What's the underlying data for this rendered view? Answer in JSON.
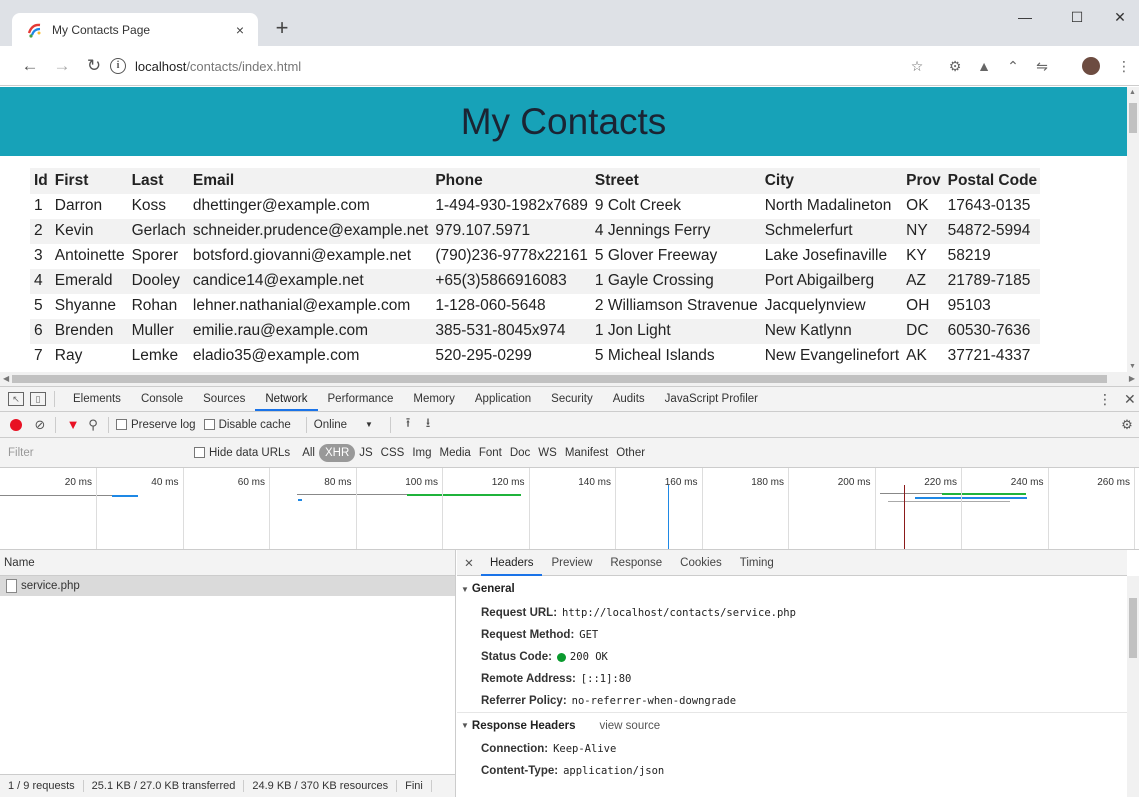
{
  "browser": {
    "tab_title": "My Contacts Page",
    "tab_close": "×",
    "new_tab": "+",
    "minimize": "—",
    "maximize": "☐",
    "close": "✕",
    "url_host": "localhost",
    "url_path": "/contacts/index.html"
  },
  "page": {
    "title": "My Contacts",
    "columns": [
      "Id",
      "First",
      "Last",
      "Email",
      "Phone",
      "Street",
      "City",
      "Prov",
      "Postal Code"
    ],
    "rows": [
      [
        "1",
        "Darron",
        "Koss",
        "dhettinger@example.com",
        "1-494-930-1982x7689",
        "9 Colt Creek",
        "North Madalineton",
        "OK",
        "17643-0135"
      ],
      [
        "2",
        "Kevin",
        "Gerlach",
        "schneider.prudence@example.net",
        "979.107.5971",
        "4 Jennings Ferry",
        "Schmelerfurt",
        "NY",
        "54872-5994"
      ],
      [
        "3",
        "Antoinette",
        "Sporer",
        "botsford.giovanni@example.net",
        "(790)236-9778x22161",
        "5 Glover Freeway",
        "Lake Josefinaville",
        "KY",
        "58219"
      ],
      [
        "4",
        "Emerald",
        "Dooley",
        "candice14@example.net",
        "+65(3)5866916083",
        "1 Gayle Crossing",
        "Port Abigailberg",
        "AZ",
        "21789-7185"
      ],
      [
        "5",
        "Shyanne",
        "Rohan",
        "lehner.nathanial@example.com",
        "1-128-060-5648",
        "2 Williamson Stravenue",
        "Jacquelynview",
        "OH",
        "95103"
      ],
      [
        "6",
        "Brenden",
        "Muller",
        "emilie.rau@example.com",
        "385-531-8045x974",
        "1 Jon Light",
        "New Katlynn",
        "DC",
        "60530-7636"
      ],
      [
        "7",
        "Ray",
        "Lemke",
        "eladio35@example.com",
        "520-295-0299",
        "5 Micheal Islands",
        "New Evangelinefort",
        "AK",
        "37721-4337"
      ]
    ]
  },
  "devtools": {
    "tabs": [
      "Elements",
      "Console",
      "Sources",
      "Network",
      "Performance",
      "Memory",
      "Application",
      "Security",
      "Audits",
      "JavaScript Profiler"
    ],
    "active_tab": "Network",
    "toolbar": {
      "preserve_log": "Preserve log",
      "disable_cache": "Disable cache",
      "throttle": "Online"
    },
    "filter": {
      "placeholder": "Filter",
      "hide_data_urls": "Hide data URLs",
      "types": [
        "All",
        "XHR",
        "JS",
        "CSS",
        "Img",
        "Media",
        "Font",
        "Doc",
        "WS",
        "Manifest",
        "Other"
      ],
      "active_type": "XHR"
    },
    "timeline_labels": [
      "20 ms",
      "40 ms",
      "60 ms",
      "80 ms",
      "100 ms",
      "120 ms",
      "140 ms",
      "160 ms",
      "180 ms",
      "200 ms",
      "220 ms",
      "240 ms",
      "260 ms"
    ],
    "request_list": {
      "header": "Name",
      "items": [
        "service.php"
      ]
    },
    "detail": {
      "tabs": [
        "Headers",
        "Preview",
        "Response",
        "Cookies",
        "Timing"
      ],
      "active_tab": "Headers",
      "general_title": "General",
      "general": [
        {
          "k": "Request URL:",
          "v": "http://localhost/contacts/service.php"
        },
        {
          "k": "Request Method:",
          "v": "GET"
        },
        {
          "k": "Status Code:",
          "v": "200 OK"
        },
        {
          "k": "Remote Address:",
          "v": "[::1]:80"
        },
        {
          "k": "Referrer Policy:",
          "v": "no-referrer-when-downgrade"
        }
      ],
      "response_title": "Response Headers",
      "view_source": "view source",
      "response": [
        {
          "k": "Connection:",
          "v": "Keep-Alive"
        },
        {
          "k": "Content-Type:",
          "v": "application/json"
        }
      ]
    },
    "status": [
      "1 / 9 requests",
      "25.1 KB / 27.0 KB transferred",
      "24.9 KB / 370 KB resources",
      "Fini"
    ]
  }
}
